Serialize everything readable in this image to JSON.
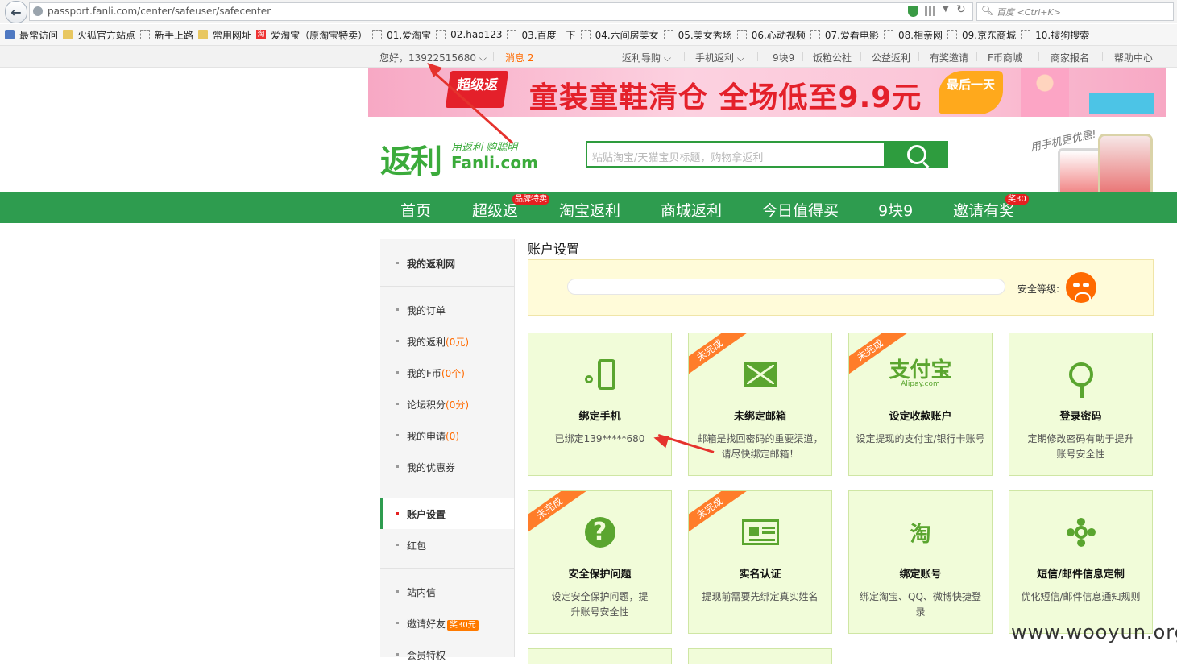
{
  "browser": {
    "url": "passport.fanli.com/center/safeuser/safecenter",
    "search_placeholder": "百度 <Ctrl+K>",
    "bookmarks": [
      "最常访问",
      "火狐官方站点",
      "新手上路",
      "常用网址",
      "爱淘宝（原淘宝特卖）",
      "01.爱淘宝",
      "02.hao123",
      "03.百度一下",
      "04.六间房美女",
      "05.美女秀场",
      "06.心动视频",
      "07.爱看电影",
      "08.相亲网",
      "09.京东商城",
      "10.搜狗搜索"
    ]
  },
  "topbar": {
    "greeting": "您好，13922515680",
    "messages": "消息 2",
    "links": [
      "返利导购",
      "手机返利",
      "9块9",
      "饭粒公社",
      "公益返利",
      "有奖邀请",
      "F币商城",
      "商家报名",
      "帮助中心"
    ]
  },
  "banner": {
    "tag": "超级返",
    "text": "童装童鞋清仓 全场低至9.9元",
    "badge": "最后一天"
  },
  "logo": {
    "mark": "返利",
    "slogan": "用返利 购聪明",
    "domain": "Fanli.com"
  },
  "search": {
    "placeholder": "粘贴淘宝/天猫宝贝标题，购物拿返利"
  },
  "phone_promo": "用手机更优惠!",
  "nav": {
    "items": [
      "首页",
      "超级返",
      "淘宝返利",
      "商城返利",
      "今日值得买",
      "9块9",
      "邀请有奖"
    ],
    "badge_superfan": "品牌特卖",
    "badge_invite": "奖30"
  },
  "sidebar": {
    "home": "我的返利网",
    "orders": "我的订单",
    "rebate": "我的返利",
    "rebate_count": "(0元)",
    "fcoin": "我的F币",
    "fcoin_count": "(0个)",
    "forum": "论坛积分",
    "forum_count": "(0分)",
    "apply": "我的申请",
    "apply_count": "(0)",
    "coupons": "我的优惠券",
    "account": "账户设置",
    "redpack": "红包",
    "inbox": "站内信",
    "invite": "邀请好友",
    "invite_badge": "奖30元",
    "member": "会员特权"
  },
  "main": {
    "title": "账户设置",
    "security_label": "安全等级:",
    "ribbon": "未完成",
    "cards": [
      {
        "title": "绑定手机",
        "desc": "已绑定139*****680",
        "icon": "phone-icon"
      },
      {
        "title": "未绑定邮箱",
        "desc": "邮箱是找回密码的重要渠道，请尽快绑定邮箱！",
        "icon": "mail-icon"
      },
      {
        "title": "设定收款账户",
        "desc": "设定提现的支付宝/银行卡账号",
        "icon": "alipay-icon",
        "icon_text": "支付宝",
        "icon_sub": "Alipay.com"
      },
      {
        "title": "登录密码",
        "desc": "定期修改密码有助于提升账号安全性",
        "icon": "key-icon"
      },
      {
        "title": "安全保护问题",
        "desc": "设定安全保护问题，提升账号安全性",
        "icon": "question-icon"
      },
      {
        "title": "实名认证",
        "desc": "提现前需要先绑定真实姓名",
        "icon": "id-card-icon"
      },
      {
        "title": "绑定账号",
        "desc": "绑定淘宝、QQ、微博快捷登录",
        "icon": "taobao-icon",
        "icon_text": "淘"
      },
      {
        "title": "短信/邮件信息定制",
        "desc": "优化短信/邮件信息通知规则",
        "icon": "gear-icon"
      }
    ]
  },
  "watermark": "www.wooyun.org",
  "colors": {
    "green": "#2e9c4f",
    "orange": "#ff6a00",
    "red": "#e52020",
    "card_bg": "#f1fcd9"
  }
}
